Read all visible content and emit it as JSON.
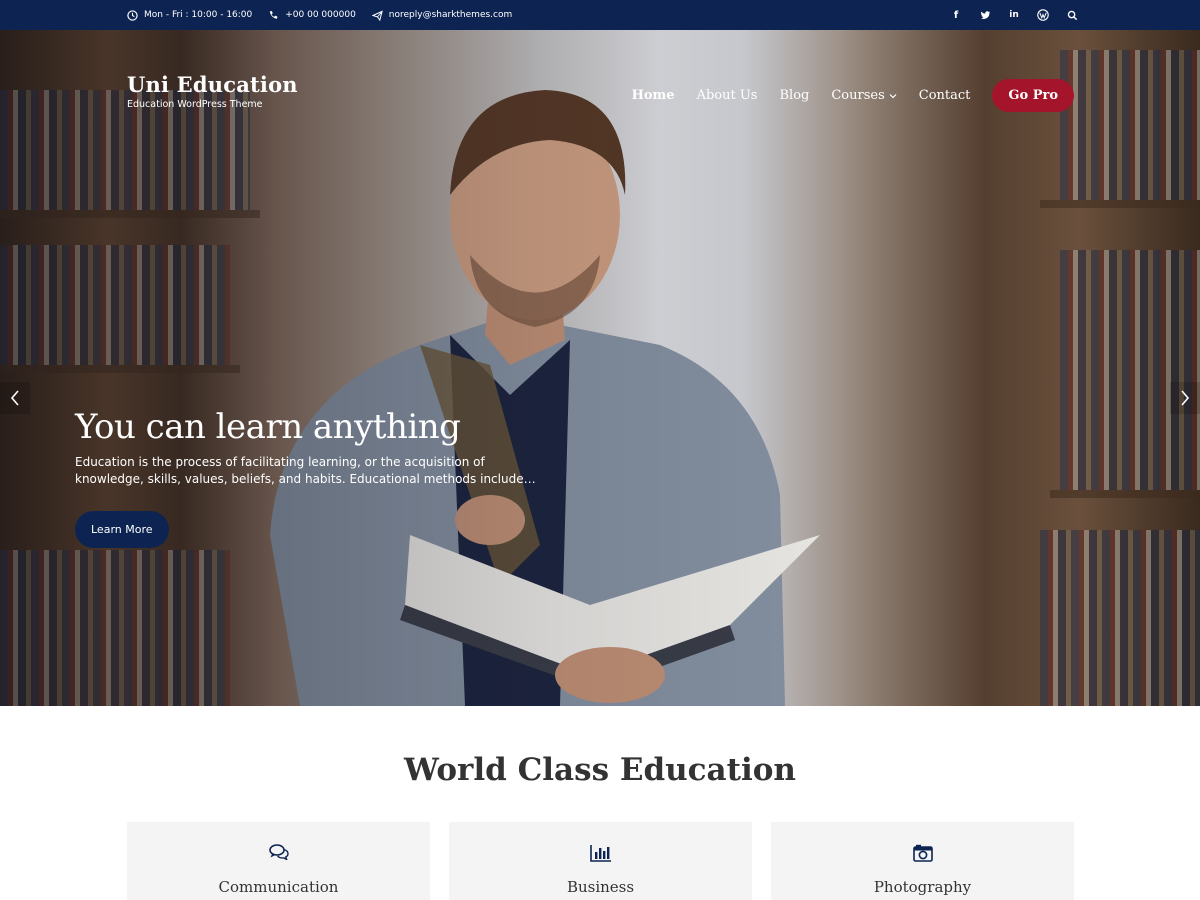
{
  "topbar": {
    "hours": "Mon - Fri : 10:00 - 16:00",
    "phone": "+00 00 000000",
    "email": "noreply@sharkthemes.com",
    "social_icons": [
      "facebook-icon",
      "twitter-icon",
      "linkedin-icon",
      "wordpress-icon",
      "search-icon"
    ]
  },
  "site": {
    "title": "Uni Education",
    "tagline": "Education WordPress Theme"
  },
  "nav": {
    "items": [
      {
        "label": "Home",
        "active": true
      },
      {
        "label": "About Us"
      },
      {
        "label": "Blog"
      },
      {
        "label": "Courses",
        "has_dropdown": true
      },
      {
        "label": "Contact"
      }
    ],
    "cta": "Go Pro"
  },
  "hero": {
    "heading": "You can learn anything",
    "text": "Education is the process of facilitating learning, or the acquisition of knowledge, skills, values, beliefs, and habits. Educational methods include…",
    "button": "Learn More"
  },
  "section": {
    "title": "World Class Education",
    "cards": [
      {
        "label": "Communication",
        "icon": "comments-icon"
      },
      {
        "label": "Business",
        "icon": "bar-chart-icon"
      },
      {
        "label": "Photography",
        "icon": "camera-icon"
      }
    ]
  },
  "colors": {
    "navy": "#0d2452",
    "accent": "#a4142b",
    "card_bg": "#f4f4f4"
  }
}
